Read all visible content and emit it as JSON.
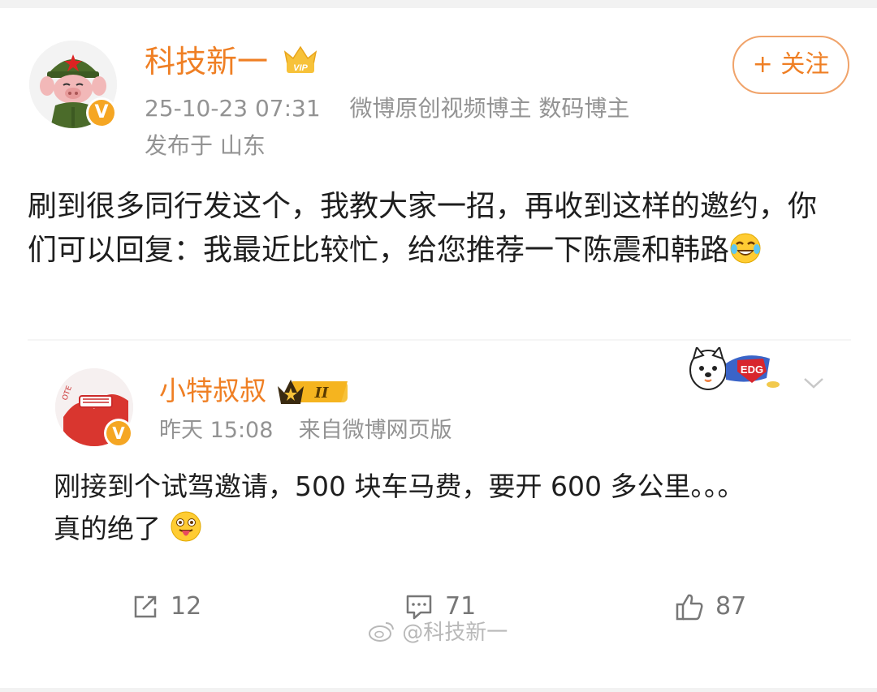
{
  "post": {
    "author": "科技新一",
    "timestamp": "25-10-23 07:31",
    "verified_tags": "微博原创视频博主 数码博主",
    "location": "发布于 山东",
    "follow_label": "+ 关注",
    "text": "刷到很多同行发这个，我教大家一招，再收到这样的邀约，你们可以回复：我最近比较忙，给您推荐一下陈震和韩路",
    "emoji": "laugh-cry-emoji"
  },
  "quoted": {
    "author": "小特叔叔",
    "time": "昨天 15:08",
    "source": "来自微博网页版",
    "text_line1": "刚接到个试驾邀请，500 块车马费，要开 600 多公里。。。",
    "text_line2": "真的绝了",
    "emoji": "tongue-out-emoji",
    "level_badge": "II",
    "sticker_text": "EDG"
  },
  "actions": {
    "share_count": "12",
    "comment_count": "71",
    "like_count": "87"
  },
  "watermark": "@科技新一",
  "colors": {
    "accent": "#ef7f24",
    "meta_text": "#939393",
    "body_text": "#1e1e1e",
    "verified_badge": "#f5a623"
  }
}
